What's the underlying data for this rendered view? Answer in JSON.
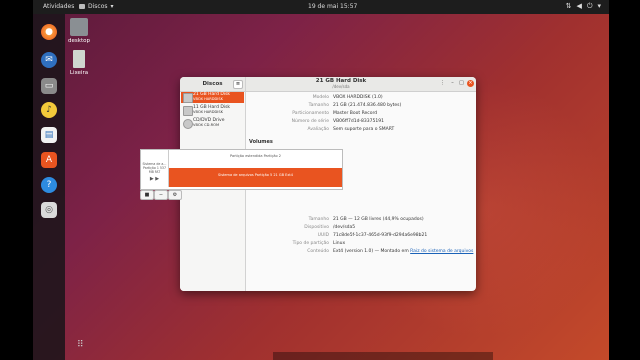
{
  "topbar": {
    "activities": "Atividades",
    "app_name": "Discos",
    "clock": "19 de mai  15:57"
  },
  "desktop": {
    "icons": [
      {
        "label": "desktop",
        "icon": "folder-icon"
      },
      {
        "label": "Lixeira",
        "icon": "trash-icon"
      }
    ]
  },
  "window": {
    "sidebar_title": "Discos",
    "main_title": "21 GB Hard Disk",
    "main_subtitle": "/dev/sda",
    "disks": [
      {
        "name": "21 GB Hard Disk",
        "sub": "VBOX HARDDISK",
        "selected": true
      },
      {
        "name": "11 GB Hard Disk",
        "sub": "VBOX HARDDISK",
        "selected": false
      },
      {
        "name": "CD/DVD Drive",
        "sub": "VBOX CD-ROM",
        "selected": false
      }
    ],
    "disk_info": [
      {
        "label": "Modelo",
        "value": "VBOX HARDDISK (1.0)"
      },
      {
        "label": "Tamanho",
        "value": "21 GB (21.474.836.480 bytes)"
      },
      {
        "label": "Particionamento",
        "value": "Master Boot Record"
      },
      {
        "label": "Número de série",
        "value": "VB06ff7d1d-83375191"
      },
      {
        "label": "Avaliação",
        "value": "Sem suporte para o SMART"
      }
    ],
    "volumes_title": "Volumes",
    "partitions": {
      "free_label": "Sistema de a… Partição 1 537 MB FAT",
      "extended_label": "Partição estendida Partição 2",
      "filesystem_label": "Sistema de arquivos Partição 5 21 GB Ext4"
    },
    "volume_tools": [
      "■",
      "−",
      "⚙"
    ],
    "partition_info": [
      {
        "label": "Tamanho",
        "value": "21 GB — 12 GB livres (44,9% ocupados)"
      },
      {
        "label": "Dispositivo",
        "value": "/dev/sda5"
      },
      {
        "label": "UUID",
        "value": "71c8de5f-1c37-465d-93f9-d294a6e98b21"
      },
      {
        "label": "Tipo de partição",
        "value": "Linux"
      },
      {
        "label": "Conteúdo",
        "value": "Ext4 (version 1.0) — Montado em",
        "link": "Raiz do sistema de arquivos"
      }
    ]
  },
  "colors": {
    "accent": "#e95420",
    "topbar": "#1d1d1d"
  }
}
